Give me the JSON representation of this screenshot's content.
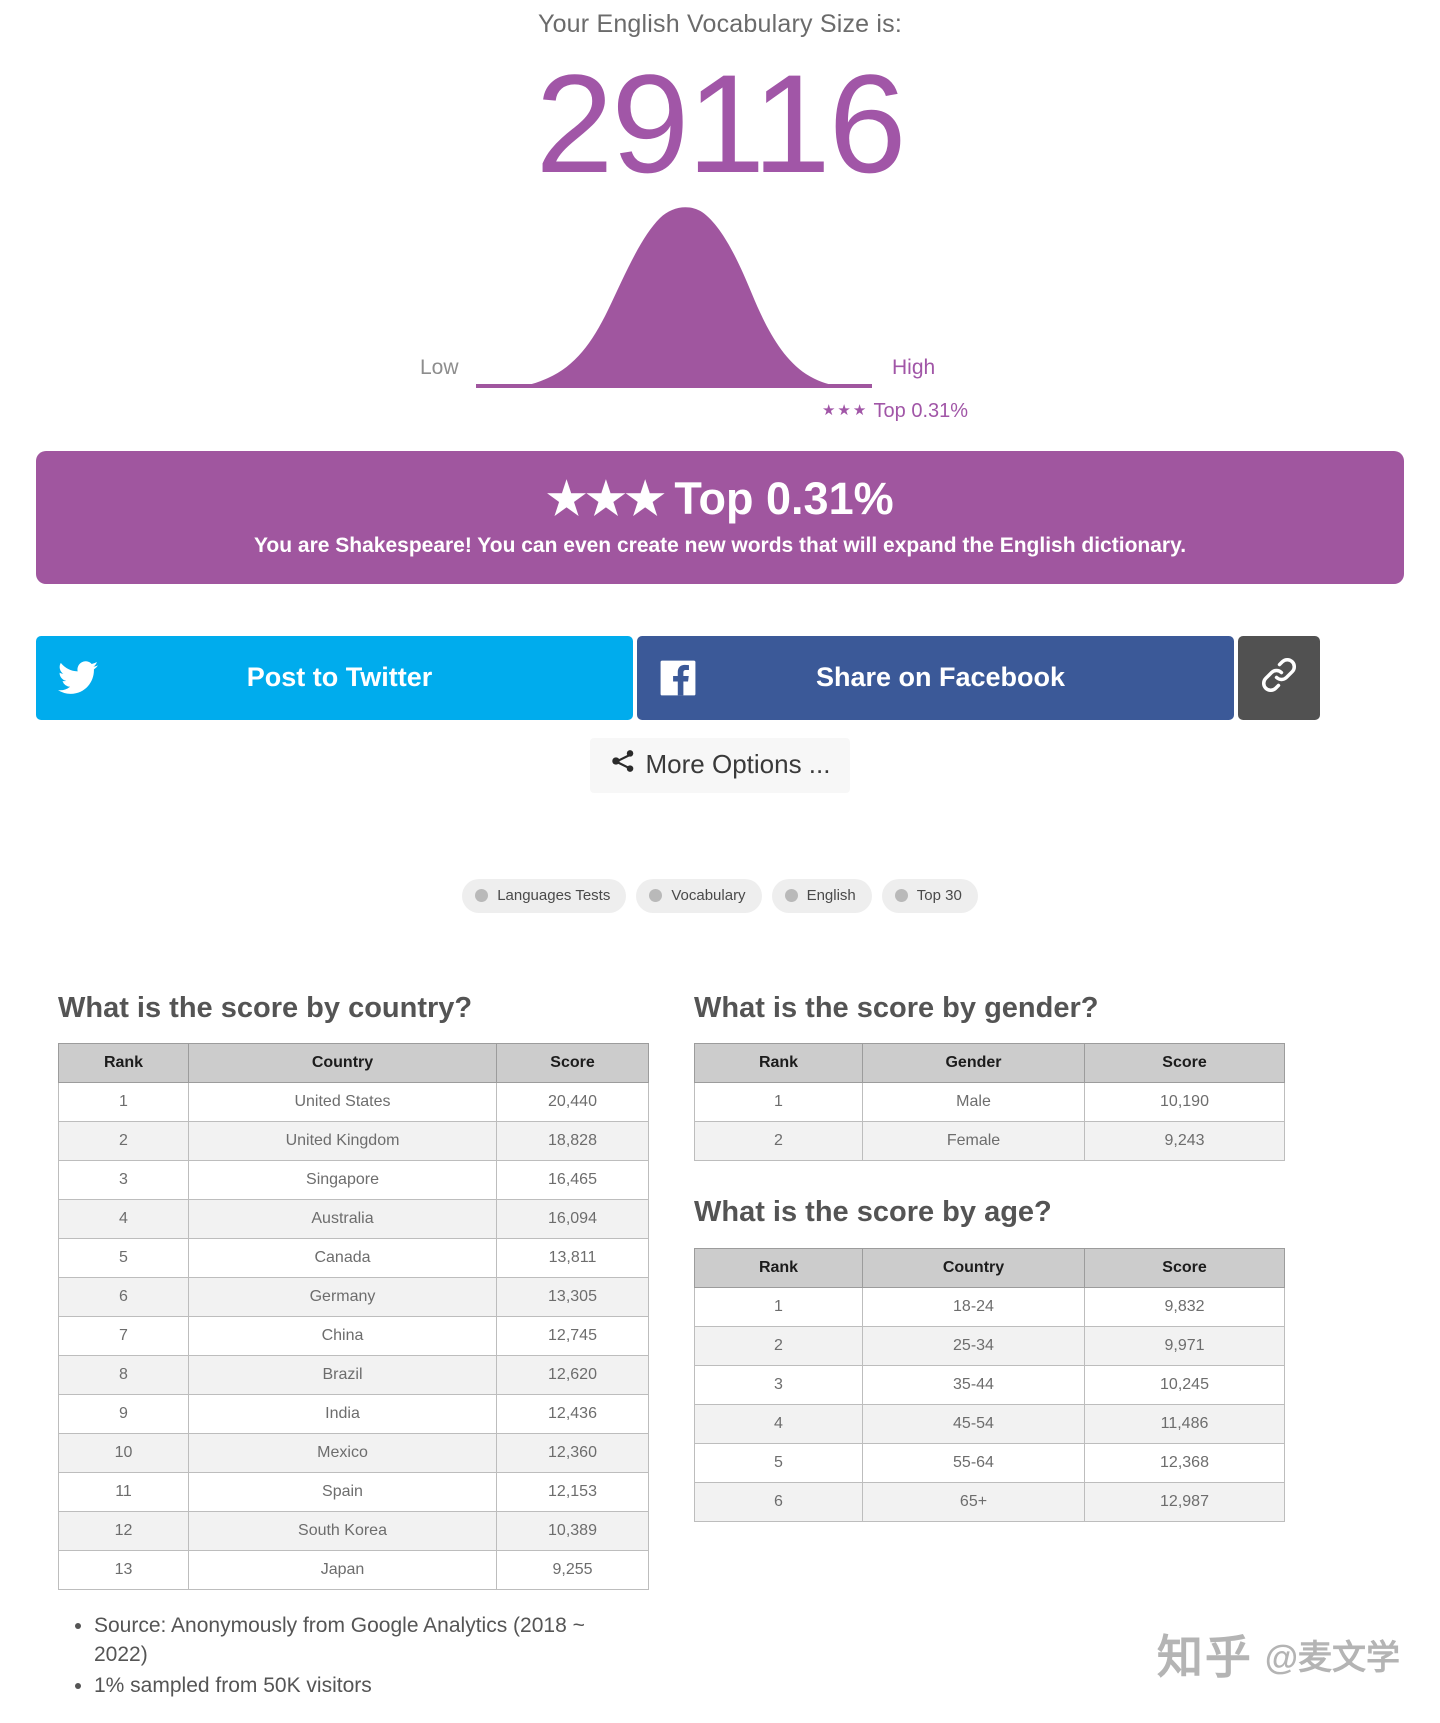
{
  "result": {
    "label": "Your English Vocabulary Size is:",
    "score": "29116",
    "accent_color": "#a156a7"
  },
  "curve": {
    "low_label": "Low",
    "high_label": "High",
    "badge_stars": "★★★",
    "badge_text": "Top 0.31%"
  },
  "banner": {
    "stars": "★★★",
    "title": "Top 0.31%",
    "subtitle": "You are Shakespeare! You can even create new words that will expand the English dictionary.",
    "background_color": "#a0569f"
  },
  "share": {
    "twitter_label": "Post to Twitter",
    "twitter_color": "#00aced",
    "facebook_label": "Share on Facebook",
    "facebook_color": "#3b5998",
    "link_color": "#515151",
    "more_label": "More Options ..."
  },
  "tags": [
    {
      "label": "Languages Tests"
    },
    {
      "label": "Vocabulary"
    },
    {
      "label": "English"
    },
    {
      "label": "Top 30"
    }
  ],
  "country_section": {
    "heading": "What is the score by country?",
    "columns": [
      "Rank",
      "Country",
      "Score"
    ],
    "rows": [
      [
        "1",
        "United States",
        "20,440"
      ],
      [
        "2",
        "United Kingdom",
        "18,828"
      ],
      [
        "3",
        "Singapore",
        "16,465"
      ],
      [
        "4",
        "Australia",
        "16,094"
      ],
      [
        "5",
        "Canada",
        "13,811"
      ],
      [
        "6",
        "Germany",
        "13,305"
      ],
      [
        "7",
        "China",
        "12,745"
      ],
      [
        "8",
        "Brazil",
        "12,620"
      ],
      [
        "9",
        "India",
        "12,436"
      ],
      [
        "10",
        "Mexico",
        "12,360"
      ],
      [
        "11",
        "Spain",
        "12,153"
      ],
      [
        "12",
        "South Korea",
        "10,389"
      ],
      [
        "13",
        "Japan",
        "9,255"
      ]
    ]
  },
  "gender_section": {
    "heading": "What is the score by gender?",
    "columns": [
      "Rank",
      "Gender",
      "Score"
    ],
    "rows": [
      [
        "1",
        "Male",
        "10,190"
      ],
      [
        "2",
        "Female",
        "9,243"
      ]
    ]
  },
  "age_section": {
    "heading": "What is the score by age?",
    "columns": [
      "Rank",
      "Country",
      "Score"
    ],
    "rows": [
      [
        "1",
        "18-24",
        "9,832"
      ],
      [
        "2",
        "25-34",
        "9,971"
      ],
      [
        "3",
        "35-44",
        "10,245"
      ],
      [
        "4",
        "45-54",
        "11,486"
      ],
      [
        "5",
        "55-64",
        "12,368"
      ],
      [
        "6",
        "65+",
        "12,987"
      ]
    ]
  },
  "notes": [
    "Source: Anonymously from Google Analytics (2018 ~ 2022)",
    "1% sampled from 50K visitors"
  ],
  "watermark": {
    "site": "知乎",
    "handle": "@麦文学"
  },
  "chart_data": {
    "type": "area",
    "title": "Vocabulary size distribution",
    "xlabel": "",
    "ylabel": "",
    "categories": [
      "Low",
      "High"
    ],
    "annotation": "★★★ Top 0.31%",
    "marker_value": "29116",
    "note": "Normal distribution bell curve; user's score marked at far right (Top 0.31%)"
  }
}
